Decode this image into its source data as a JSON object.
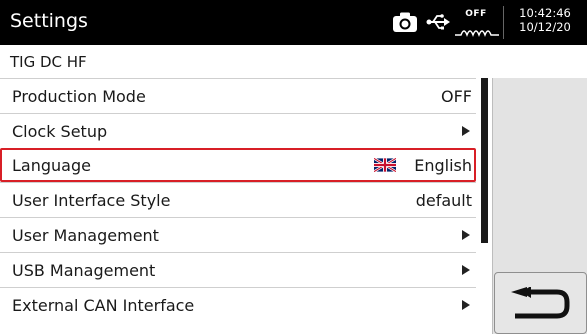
{
  "header": {
    "title": "Settings",
    "off_label": "OFF",
    "time": "10:42:46",
    "date": "10/12/20",
    "icons": [
      "camera-icon",
      "usb-icon",
      "off-wave-icon"
    ]
  },
  "subtitle": "TIG DC HF",
  "menu": {
    "items": [
      {
        "label": "Production Mode",
        "value": "OFF"
      },
      {
        "label": "Clock Setup",
        "value": ""
      },
      {
        "label": "Language",
        "value": "English"
      },
      {
        "label": "User Interface Style",
        "value": "default"
      },
      {
        "label": "User Management",
        "value": ""
      },
      {
        "label": "USB Management",
        "value": ""
      },
      {
        "label": "External CAN Interface",
        "value": ""
      }
    ],
    "selected_index": 2
  },
  "colors": {
    "selection_border": "#d81f26",
    "titlebar": "#000000"
  },
  "back_button": {
    "icon": "return-arrow-icon"
  }
}
